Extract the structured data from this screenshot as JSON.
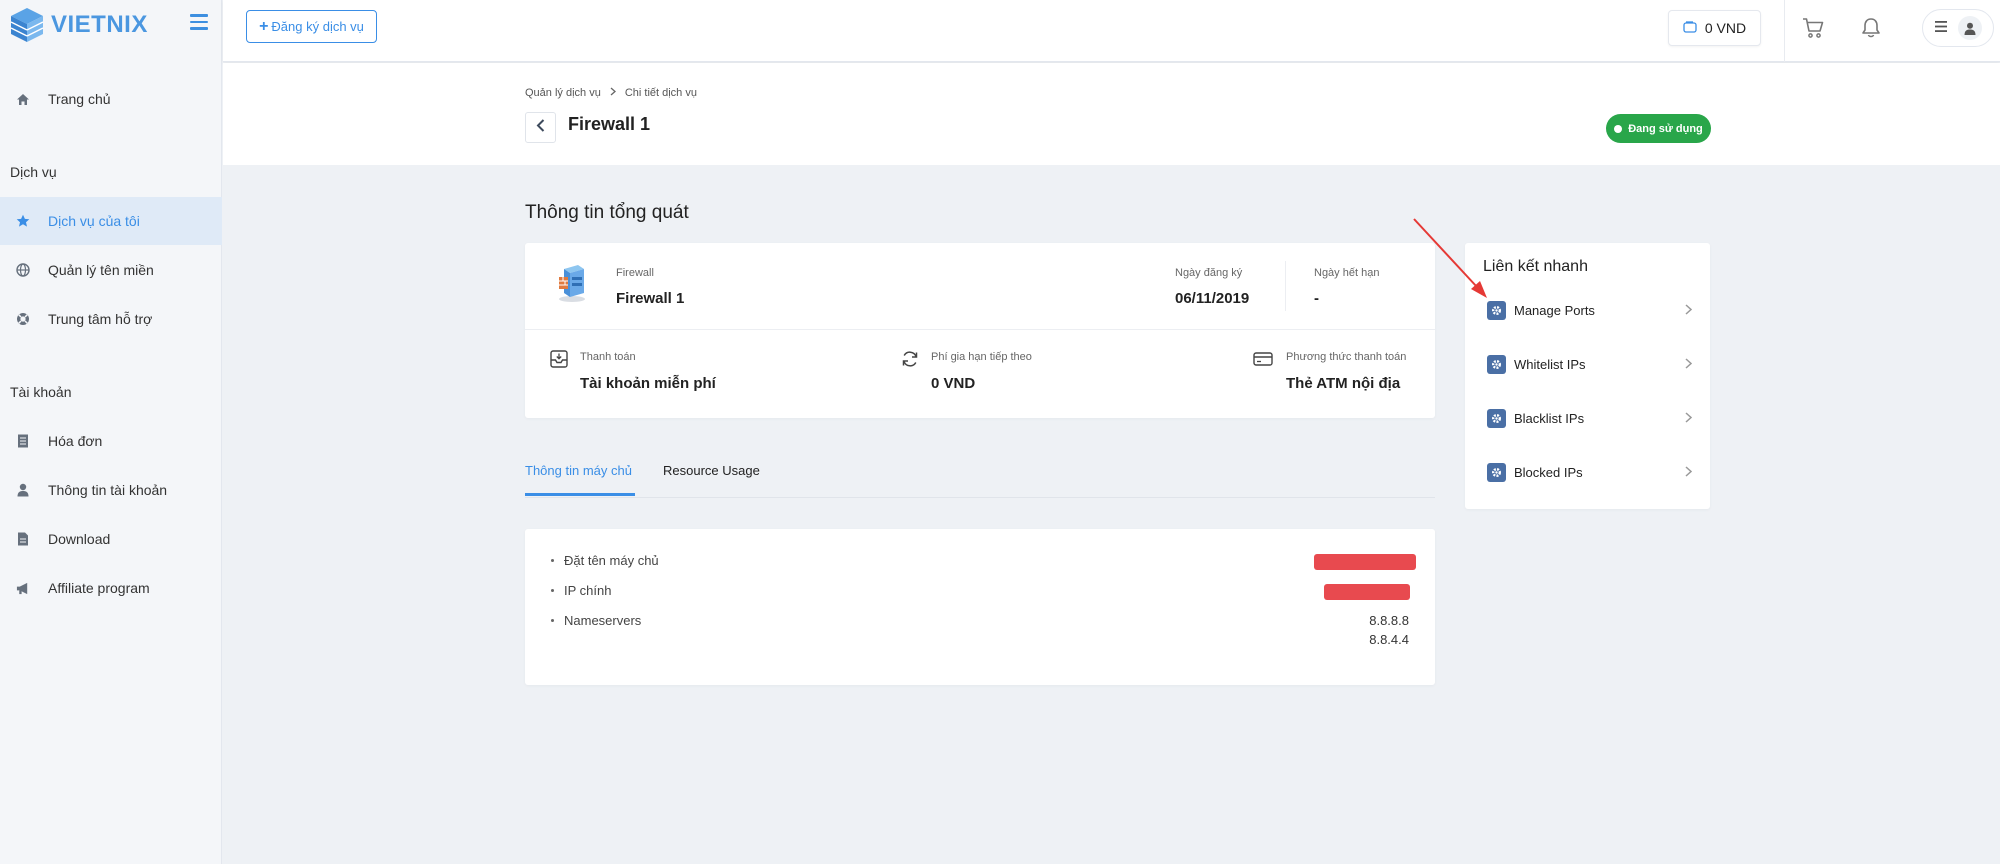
{
  "brand": {
    "logo_text": "VIETNIX"
  },
  "sidebar": {
    "items_top": [
      {
        "label": "Trang chủ",
        "icon": "home-icon"
      }
    ],
    "section_services": "Dịch vụ",
    "services": [
      {
        "label": "Dịch vụ của tôi",
        "icon": "star-icon",
        "active": true
      },
      {
        "label": "Quản lý tên miền",
        "icon": "globe-icon"
      },
      {
        "label": "Trung tâm hỗ trợ",
        "icon": "lifebuoy-icon"
      }
    ],
    "section_account": "Tài khoản",
    "account": [
      {
        "label": "Hóa đơn",
        "icon": "invoice-icon"
      },
      {
        "label": "Thông tin tài khoản",
        "icon": "user-icon"
      },
      {
        "label": "Download",
        "icon": "file-icon"
      },
      {
        "label": "Affiliate program",
        "icon": "megaphone-icon"
      }
    ]
  },
  "header": {
    "register_label": "Đăng ký dịch vụ",
    "balance": "0 VND"
  },
  "page": {
    "breadcrumb": [
      "Quản lý dịch vụ",
      "Chi tiết dịch vụ"
    ],
    "title": "Firewall 1",
    "status": "Đang sử dụng",
    "status_color": "#29a64a",
    "section_heading": "Thông tin tổng quát"
  },
  "summary": {
    "product_label": "Firewall",
    "product_name": "Firewall 1",
    "reg_date_label": "Ngày đăng ký",
    "reg_date": "06/11/2019",
    "expiry_label": "Ngày hết hạn",
    "expiry": "-",
    "payment_label": "Thanh toán",
    "payment": "Tài khoản miễn phí",
    "renewal_label": "Phí gia hạn tiếp theo",
    "renewal": "0 VND",
    "method_label": "Phương thức thanh toán",
    "method": "Thẻ ATM nội địa"
  },
  "tabs": [
    "Thông tin máy chủ",
    "Resource Usage"
  ],
  "server_info": {
    "rows": [
      {
        "label": "Đặt tên máy chủ"
      },
      {
        "label": "IP chính"
      },
      {
        "label": "Nameservers",
        "values": [
          "8.8.8.8",
          "8.8.4.4"
        ]
      }
    ]
  },
  "quick_links": {
    "title": "Liên kết nhanh",
    "items": [
      "Manage Ports",
      "Whitelist IPs",
      "Blacklist IPs",
      "Blocked IPs"
    ]
  },
  "colors": {
    "accent": "#3a8ee6",
    "redaction": "#e84a4f",
    "annotation_arrow": "#e53935"
  }
}
